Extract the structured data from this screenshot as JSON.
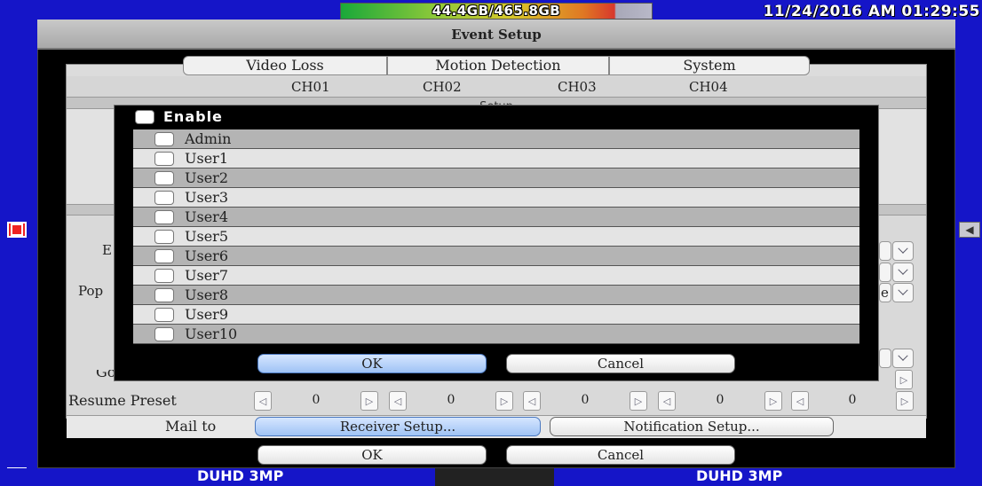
{
  "status": {
    "hdd_usage": "44.4GB/465.8GB",
    "datetime": "11/24/2016 AM 01:29:55"
  },
  "window": {
    "title": "Event Setup"
  },
  "tabs": [
    "Video Loss",
    "Motion Detection",
    "System"
  ],
  "channels": [
    "CH01",
    "CH02",
    "CH03",
    "CH04"
  ],
  "section_setup": "Setup",
  "partial_labels": {
    "left_a": "E",
    "left_b": "Pop",
    "combo_c": "e"
  },
  "presets": {
    "goto_label": "Go To Preset",
    "resume_label": "Resume Preset",
    "resume_values": [
      "0",
      "0",
      "0",
      "0",
      "0"
    ]
  },
  "mail": {
    "label": "Mail to",
    "receiver_button": "Receiver Setup...",
    "notification_button": "Notification Setup..."
  },
  "footer_buttons": {
    "ok": "OK",
    "cancel": "Cancel"
  },
  "dialog": {
    "enable_label": "Enable",
    "users": [
      "Admin",
      "User1",
      "User2",
      "User3",
      "User4",
      "User5",
      "User6",
      "User7",
      "User8",
      "User9",
      "User10"
    ],
    "ok": "OK",
    "cancel": "Cancel"
  },
  "bottom_bar": {
    "left_label": "DUHD 3MP",
    "right_label": "DUHD 3MP"
  },
  "colors": {
    "background": "#1515c8",
    "row_dark": "#b4b4b4",
    "row_light": "#e4e4e4",
    "button_blue": "#9fc3f5"
  }
}
